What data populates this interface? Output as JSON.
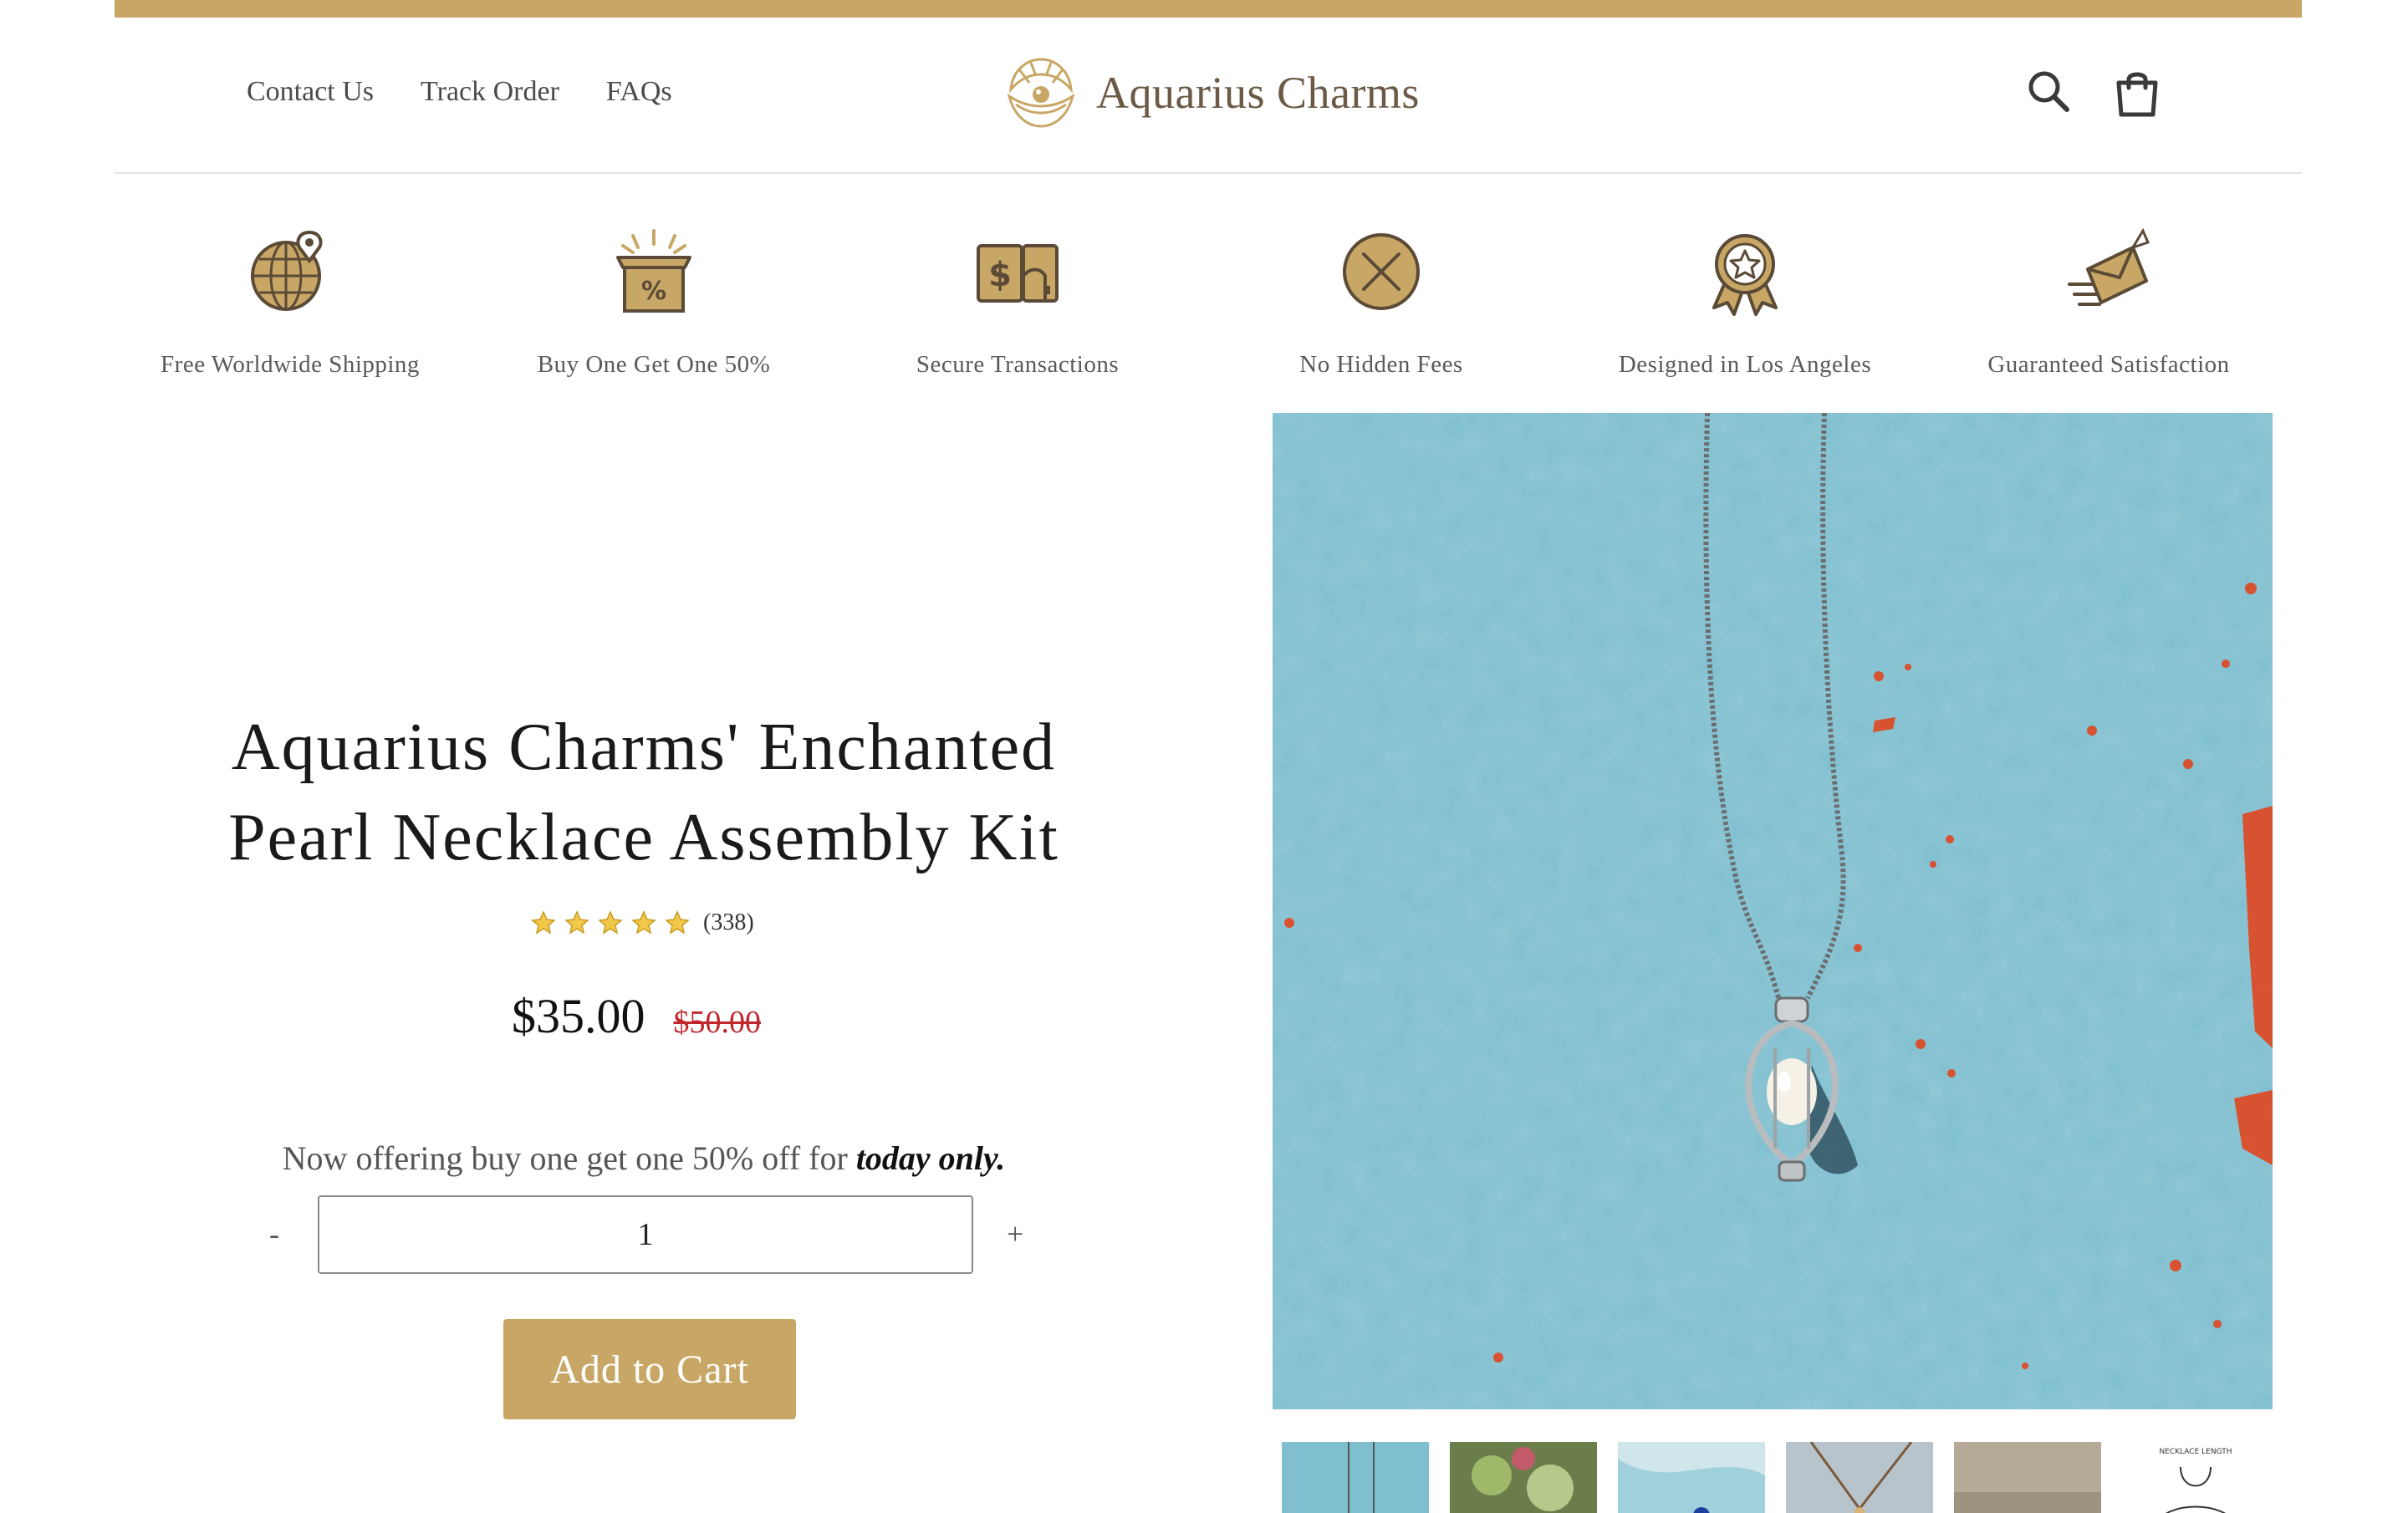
{
  "brand": {
    "name": "Aquarius Charms",
    "accent_color": "#c8a766"
  },
  "nav": {
    "items": [
      "Contact Us",
      "Track Order",
      "FAQs"
    ]
  },
  "header_icons": [
    "search-icon",
    "shopping-bag-icon"
  ],
  "features": [
    {
      "label": "Free Worldwide Shipping",
      "icon": "globe-pin-icon"
    },
    {
      "label": "Buy One Get One 50%",
      "icon": "discount-box-icon"
    },
    {
      "label": "Secure Transactions",
      "icon": "dollar-card-icon"
    },
    {
      "label": "No Hidden Fees",
      "icon": "x-circle-icon"
    },
    {
      "label": "Designed in Los Angeles",
      "icon": "star-badge-icon"
    },
    {
      "label": "Guaranteed Satisfaction",
      "icon": "fast-envelope-icon"
    }
  ],
  "product": {
    "title_line1": "Aquarius Charms' Enchanted",
    "title_line2": "Pearl Necklace Assembly Kit",
    "rating_stars": 5,
    "review_count": "(338)",
    "price": "$35.00",
    "compare_price": "$50.00",
    "offer_text": "Now offering buy one get one 50% off for",
    "offer_emphasis": "today only.",
    "quantity": "1",
    "qty_minus": "-",
    "qty_plus": "+",
    "add_to_cart": "Add to Cart",
    "price_color": "#c0262c"
  },
  "gallery": {
    "thumbnail_count": 6,
    "thumbnail_6_text": "NECKLACE LENGTH"
  }
}
